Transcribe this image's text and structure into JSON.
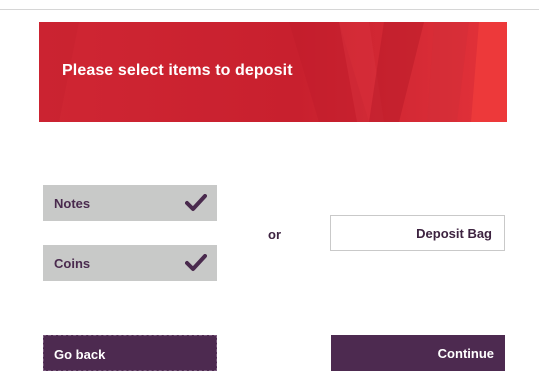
{
  "banner": {
    "title": "Please select items to deposit"
  },
  "options": {
    "notes_label": "Notes",
    "coins_label": "Coins"
  },
  "separator": {
    "or_text": "or"
  },
  "deposit_bag": {
    "label": "Deposit Bag"
  },
  "footer": {
    "back_label": "Go back",
    "continue_label": "Continue"
  },
  "colors": {
    "banner_red": "#cf2633",
    "accent_purple": "#4d2a50",
    "option_grey": "#c8c9c8",
    "text_purple": "#4a2a4e"
  },
  "icons": {
    "selected": "check-icon"
  }
}
